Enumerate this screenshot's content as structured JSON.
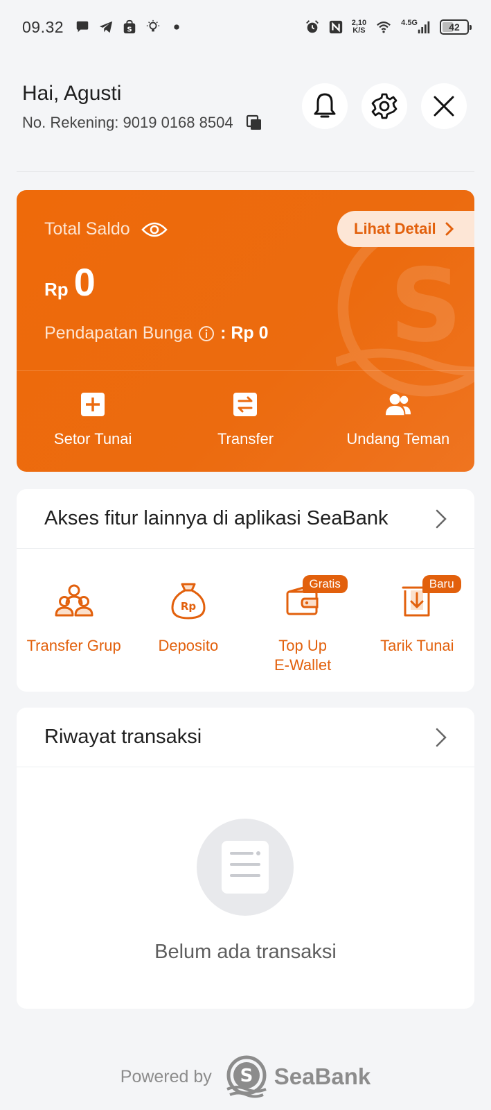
{
  "status": {
    "time": "09.32",
    "speed_top": "2,10",
    "speed_bottom": "K/S",
    "network": "4.5G",
    "battery": "42"
  },
  "header": {
    "greeting": "Hai, Agusti",
    "account": "No. Rekening: 9019 0168 8504"
  },
  "card": {
    "saldo_label": "Total Saldo",
    "detail_label": "Lihat Detail",
    "currency": "Rp",
    "amount": "0",
    "interest_label": "Pendapatan Bunga",
    "interest_value": ": Rp 0",
    "actions": [
      {
        "label": "Setor Tunai"
      },
      {
        "label": "Transfer"
      },
      {
        "label": "Undang Teman"
      }
    ]
  },
  "features": {
    "title": "Akses fitur lainnya di aplikasi SeaBank",
    "items": [
      {
        "label": "Transfer Grup",
        "badge": ""
      },
      {
        "label": "Deposito",
        "badge": ""
      },
      {
        "label": "Top Up\nE-Wallet",
        "badge": "Gratis"
      },
      {
        "label": "Tarik Tunai",
        "badge": "Baru"
      }
    ]
  },
  "history": {
    "title": "Riwayat transaksi",
    "empty": "Belum ada transaksi"
  },
  "footer": {
    "powered": "Powered by",
    "brand": "SeaBank"
  },
  "colors": {
    "accent": "#ec6b0f",
    "accent_text": "#e2600c",
    "background": "#f4f5f7"
  }
}
